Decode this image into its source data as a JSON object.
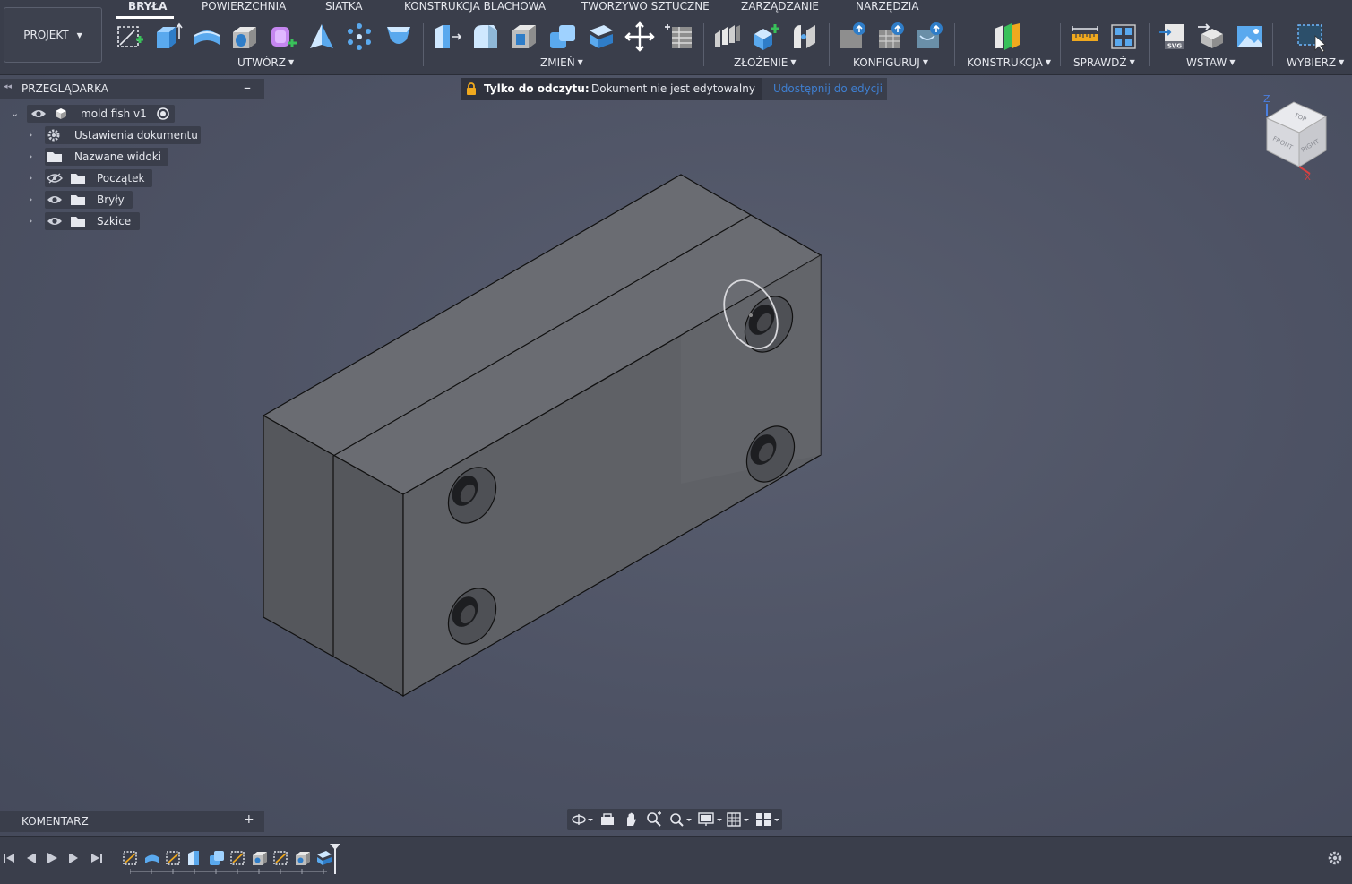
{
  "toolbar": {
    "project_label": "PROJEKT",
    "tabs": [
      {
        "label": "BRYŁA",
        "active": true
      },
      {
        "label": "POWIERZCHNIA"
      },
      {
        "label": "SIATKA"
      },
      {
        "label": "KONSTRUKCJA BLACHOWA"
      },
      {
        "label": "TWORZYWO SZTUCZNE"
      },
      {
        "label": "ZARZĄDZANIE"
      },
      {
        "label": "NARZĘDZIA"
      }
    ],
    "groups": {
      "create": "UTWÓRZ",
      "modify": "ZMIEŃ",
      "assemble": "ZŁOŻENIE",
      "configure": "KONFIGURUJ",
      "construct": "KONSTRUKCJA",
      "inspect": "SPRAWDŹ",
      "insert": "WSTAW",
      "select": "WYBIERZ"
    },
    "svg_badge": "SVG"
  },
  "browser": {
    "title": "PRZEGLĄDARKA",
    "root": "mold fish v1",
    "items": [
      {
        "label": "Ustawienia dokumentu"
      },
      {
        "label": "Nazwane widoki"
      },
      {
        "label": "Początek"
      },
      {
        "label": "Bryły"
      },
      {
        "label": "Szkice"
      }
    ]
  },
  "banner": {
    "readonly_label": "Tylko do odczytu:",
    "message": "Dokument nie jest edytowalny",
    "share_link": "Udostępnij do edycji"
  },
  "viewcube": {
    "top": "TOP",
    "front": "FRONT",
    "right": "RIGHT",
    "axis_z": "Z",
    "axis_x": "X"
  },
  "comments": {
    "title": "KOMENTARZ"
  },
  "colors": {
    "accent": "#3f7fd0",
    "toolbar_bg": "#3a3e4b",
    "viewport_bg": "#4c5163",
    "lock": "#f0a91e"
  }
}
